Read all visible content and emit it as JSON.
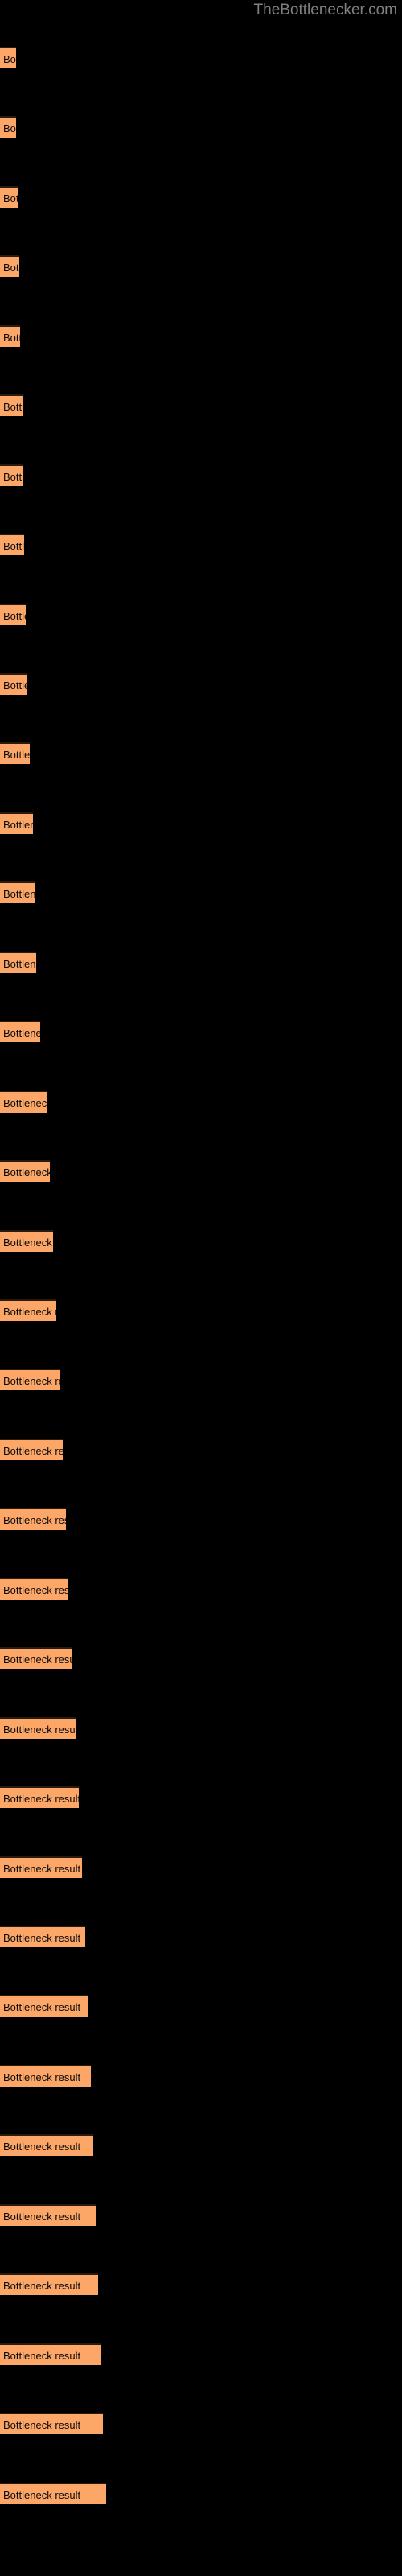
{
  "watermark": {
    "text": "TheBottlenecker.com"
  },
  "chart_data": {
    "type": "bar",
    "orientation": "horizontal",
    "title": "",
    "subtitle": "",
    "xlabel": "",
    "ylabel": "",
    "grid": false,
    "legend": null,
    "background_color": "#000000",
    "bar_color": "#fca768",
    "bar_edge_color": "#2a1a0e",
    "label_color": "#0a0a0a",
    "watermark_color": "#808080",
    "bar_label": "Bottleneck result",
    "xlim": [
      0,
      500
    ],
    "categories": [
      "Bottleneck result",
      "Bottleneck result",
      "Bottleneck result",
      "Bottleneck result",
      "Bottleneck result",
      "Bottleneck result",
      "Bottleneck result",
      "Bottleneck result",
      "Bottleneck result",
      "Bottleneck result",
      "Bottleneck result",
      "Bottleneck result",
      "Bottleneck result",
      "Bottleneck result",
      "Bottleneck result",
      "Bottleneck result",
      "Bottleneck result",
      "Bottleneck result",
      "Bottleneck result",
      "Bottleneck result",
      "Bottleneck result",
      "Bottleneck result",
      "Bottleneck result",
      "Bottleneck result",
      "Bottleneck result",
      "Bottleneck result",
      "Bottleneck result",
      "Bottleneck result",
      "Bottleneck result",
      "Bottleneck result",
      "Bottleneck result",
      "Bottleneck result",
      "Bottleneck result",
      "Bottleneck result",
      "Bottleneck result",
      "Bottleneck result"
    ],
    "values": [
      20,
      20,
      22,
      24,
      25,
      28,
      29,
      30,
      32,
      34,
      37,
      41,
      43,
      45,
      50,
      58,
      62,
      66,
      70,
      75,
      78,
      82,
      85,
      90,
      95,
      98,
      102,
      106,
      110,
      113,
      116,
      119,
      122,
      125,
      128,
      132
    ],
    "bar_tops": [
      58,
      101,
      144,
      187,
      230,
      273,
      316,
      359,
      402,
      445,
      488,
      531,
      574,
      617,
      660,
      703,
      746,
      789,
      832,
      875,
      918,
      961,
      1004,
      1047,
      1090,
      1133,
      1176,
      1219,
      1262,
      1305,
      1348,
      1391,
      1434,
      1477,
      1520,
      1563
    ]
  }
}
